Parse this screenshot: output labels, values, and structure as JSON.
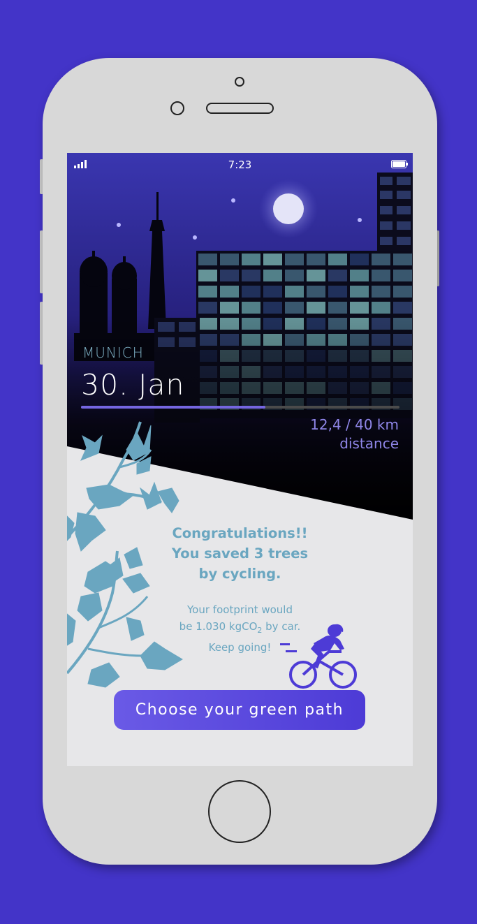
{
  "status_bar": {
    "time": "7:23"
  },
  "header": {
    "city": "MUNICH",
    "date": "30. Jan",
    "distance_value": "12,4 / 40 km",
    "distance_label": "distance",
    "progress": {
      "current_km": 12.4,
      "total_km": 40,
      "fraction": 0.58
    }
  },
  "message": {
    "congrats_lines": [
      "Congratulations!!",
      "You saved 3 trees",
      "by cycling."
    ],
    "footprint_line1": "Your footprint would",
    "footprint_line2_pre": "be 1.030 kgCO",
    "footprint_sub": "2",
    "footprint_line2_post": " by car.",
    "footprint_line3": "Keep going!"
  },
  "cta": {
    "label": "Choose your green path"
  },
  "colors": {
    "background": "#4334c8",
    "accent": "#6a5ae6",
    "text_teal": "#6aa6c0",
    "distance_purple": "#8f86e8"
  },
  "icons": [
    "signal-icon",
    "battery-icon",
    "moon-icon",
    "cyclist-icon",
    "leaf-branch-icon"
  ]
}
